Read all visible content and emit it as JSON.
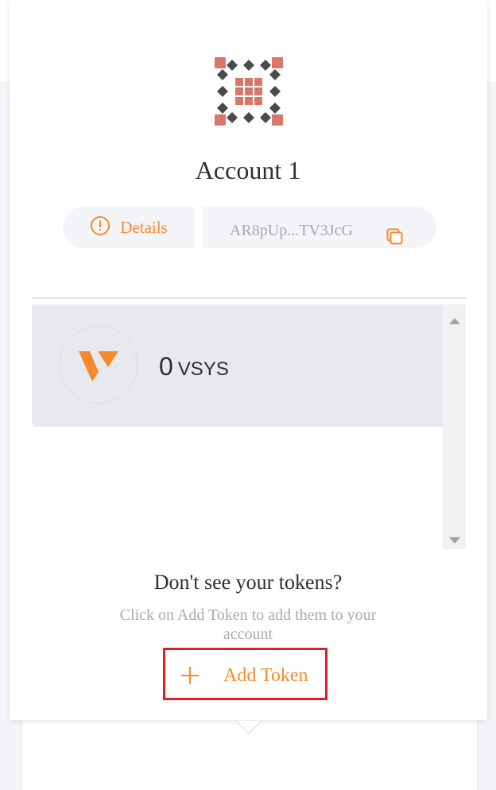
{
  "account": {
    "name": "Account 1",
    "details_label": "Details",
    "address_short": "AR8pUp...TV3JcG"
  },
  "tokens": [
    {
      "amount": "0",
      "symbol": "VSYS"
    }
  ],
  "empty_hint": {
    "title": "Don't see your tokens?",
    "description": "Click on Add Token to add them to your account"
  },
  "actions": {
    "add_token_label": "Add Token"
  },
  "colors": {
    "accent": "#f7892c",
    "highlight_border": "#e21e26",
    "token_row_bg": "#e8e9ef",
    "avatar_red": "#d9766a",
    "avatar_dark": "#4a4a4a"
  },
  "icons": {
    "details": "info-circle-icon",
    "copy": "copy-icon",
    "token_logo": "vsys-logo-icon",
    "add": "plus-icon",
    "scroll_up": "triangle-up-icon",
    "scroll_down": "triangle-down-icon"
  }
}
